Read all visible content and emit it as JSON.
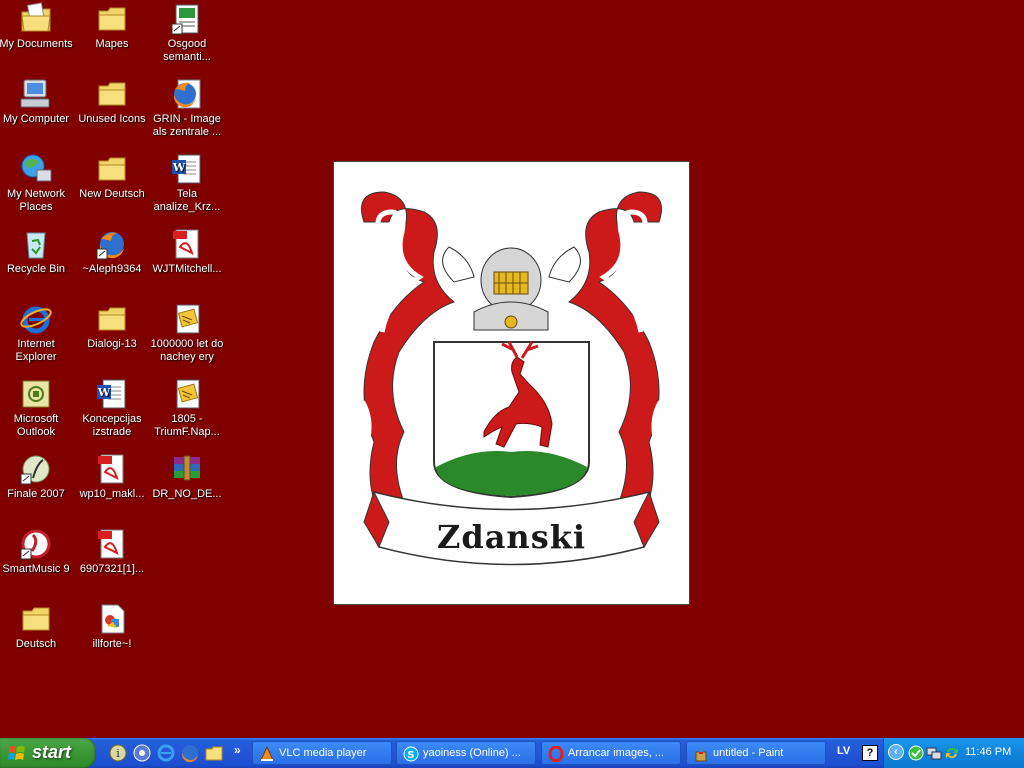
{
  "desktop": {
    "background_color": "#800000",
    "icons": [
      {
        "label": "My Documents",
        "icon": "my-documents-icon"
      },
      {
        "label": "Mapes",
        "icon": "folder-icon"
      },
      {
        "label": "Osgood semanti...",
        "icon": "document-icon"
      },
      {
        "label": "My Computer",
        "icon": "my-computer-icon"
      },
      {
        "label": "Unused Icons",
        "icon": "folder-icon"
      },
      {
        "label": "GRIN - Image als zentrale ...",
        "icon": "firefox-icon"
      },
      {
        "label": "My Network Places",
        "icon": "network-places-icon"
      },
      {
        "label": "New Deutsch",
        "icon": "folder-icon"
      },
      {
        "label": "Tela analize_Krz...",
        "icon": "word-doc-icon"
      },
      {
        "label": "Recycle Bin",
        "icon": "recycle-bin-icon"
      },
      {
        "label": "~Aleph9364",
        "icon": "firefox-icon"
      },
      {
        "label": "WJTMitchell...",
        "icon": "pdf-icon"
      },
      {
        "label": "Internet Explorer",
        "icon": "internet-explorer-icon"
      },
      {
        "label": "Dialogi-13",
        "icon": "folder-icon"
      },
      {
        "label": "1000000 let do nachey ery",
        "icon": "document-icon"
      },
      {
        "label": "Microsoft Outlook",
        "icon": "outlook-icon"
      },
      {
        "label": "Koncepcijas izstrade",
        "icon": "word-doc-icon"
      },
      {
        "label": "1805 - TriumF.Nap...",
        "icon": "document-icon"
      },
      {
        "label": "Finale 2007",
        "icon": "finale-icon"
      },
      {
        "label": "wp10_makl...",
        "icon": "pdf-icon"
      },
      {
        "label": "DR_NO_DE...",
        "icon": "winrar-icon"
      },
      {
        "label": "SmartMusic 9",
        "icon": "smartmusic-icon"
      },
      {
        "label": "6907321[1]...",
        "icon": "pdf-icon"
      },
      {
        "label": "Deutsch",
        "icon": "folder-icon"
      },
      {
        "label": "illforte~!",
        "icon": "image-file-icon"
      }
    ]
  },
  "crest": {
    "name": "Zdanski",
    "colors": {
      "red": "#cc1a1a",
      "green": "#2a8a2a",
      "gold": "#e6b820"
    }
  },
  "taskbar": {
    "start_label": "start",
    "quick_launch": [
      "info-icon",
      "media-icon",
      "ie-icon",
      "firefox-icon",
      "folder-icon"
    ],
    "chevron": "»",
    "tasks": [
      {
        "label": "VLC media player",
        "icon": "vlc-icon"
      },
      {
        "label": "yaoiness (Online) ...",
        "icon": "skype-icon"
      },
      {
        "label": "Arrancar images, ...",
        "icon": "opera-icon"
      },
      {
        "label": "untitled - Paint",
        "icon": "paint-icon"
      }
    ],
    "language": "LV",
    "help": "?",
    "clock": "11:46 PM"
  }
}
